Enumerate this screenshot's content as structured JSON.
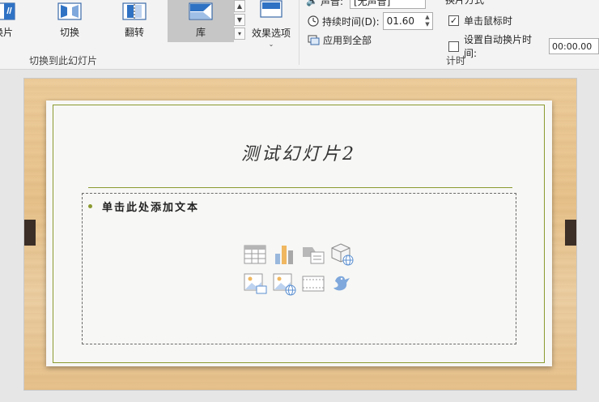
{
  "ribbon": {
    "gallery": [
      {
        "label": "换片",
        "icon": "cut-transition-icon"
      },
      {
        "label": "切换",
        "icon": "switch-transition-icon"
      },
      {
        "label": "翻转",
        "icon": "flip-transition-icon"
      },
      {
        "label": "库",
        "icon": "gallery-transition-icon",
        "selected": true
      }
    ],
    "effects_label": "效果选项",
    "group_transition_label": "切换到此幻灯片",
    "timing": {
      "sound_label": "声音:",
      "sound_value": "[无声音]",
      "duration_label": "持续时间(D):",
      "duration_value": "01.60",
      "apply_all_label": "应用到全部",
      "advance_heading": "换片方式",
      "on_click_label": "单击鼠标时",
      "on_click_checked": true,
      "after_label": "设置自动换片时间:",
      "after_checked": false,
      "after_value": "00:00.00",
      "group_label": "计时"
    }
  },
  "slide": {
    "title": "测试幻灯片2",
    "bullet": "单击此处添加文本",
    "accent_color": "#8b9a2f",
    "placeholder_icons": [
      "table-icon",
      "chart-icon",
      "smartart-icon",
      "3d-model-icon",
      "picture-icon",
      "online-picture-icon",
      "video-icon",
      "icon-insert-icon"
    ]
  }
}
